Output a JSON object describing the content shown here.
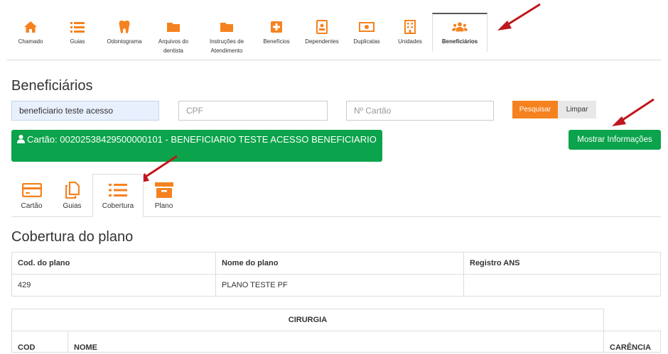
{
  "nav": {
    "items": [
      {
        "label": "Chamado",
        "icon": "home-icon"
      },
      {
        "label": "Guias",
        "icon": "list-icon"
      },
      {
        "label": "Odontograma",
        "icon": "tooth-icon"
      },
      {
        "label": "Arquivos do dentista",
        "icon": "folder-icon"
      },
      {
        "label": "Instruções de Atendimento",
        "icon": "folder-icon"
      },
      {
        "label": "Benefícios",
        "icon": "plus-square-icon"
      },
      {
        "label": "Dependentes",
        "icon": "id-badge-icon"
      },
      {
        "label": "Duplicatas",
        "icon": "money-bill-icon"
      },
      {
        "label": "Unidades",
        "icon": "building-icon"
      },
      {
        "label": "Beneficiários",
        "icon": "users-icon"
      }
    ],
    "active": "Beneficiários"
  },
  "page": {
    "title": "Beneficiários"
  },
  "search": {
    "name_value": "beneficiario teste acesso",
    "cpf_placeholder": "CPF",
    "card_placeholder": "Nº Cartão",
    "search_label": "Pesquisar",
    "clear_label": "Limpar"
  },
  "card": {
    "text": "Cartão: 00202538429500000101 - BENEFICIARIO TESTE ACESSO BENEFICIARIO"
  },
  "show_info_label": "Mostrar Informações",
  "subtabs": [
    {
      "label": "Cartão",
      "icon": "credit-card-icon"
    },
    {
      "label": "Guias",
      "icon": "copy-icon"
    },
    {
      "label": "Cobertura",
      "icon": "list-icon"
    },
    {
      "label": "Plano",
      "icon": "archive-icon"
    }
  ],
  "subtab_active": "Cobertura",
  "coverage": {
    "title": "Cobertura do plano",
    "columns": [
      "Cod. do plano",
      "Nome do plano",
      "Registro ANS"
    ],
    "rows": [
      [
        "429",
        "PLANO TESTE PF",
        ""
      ]
    ],
    "surgery": {
      "title": "CIRURGIA",
      "columns": [
        "COD",
        "NOME",
        "CARÊNCIA"
      ]
    }
  },
  "colors": {
    "accent_orange": "#f5821f",
    "success_green": "#0ba34b",
    "arrow_red": "#c0161c"
  }
}
